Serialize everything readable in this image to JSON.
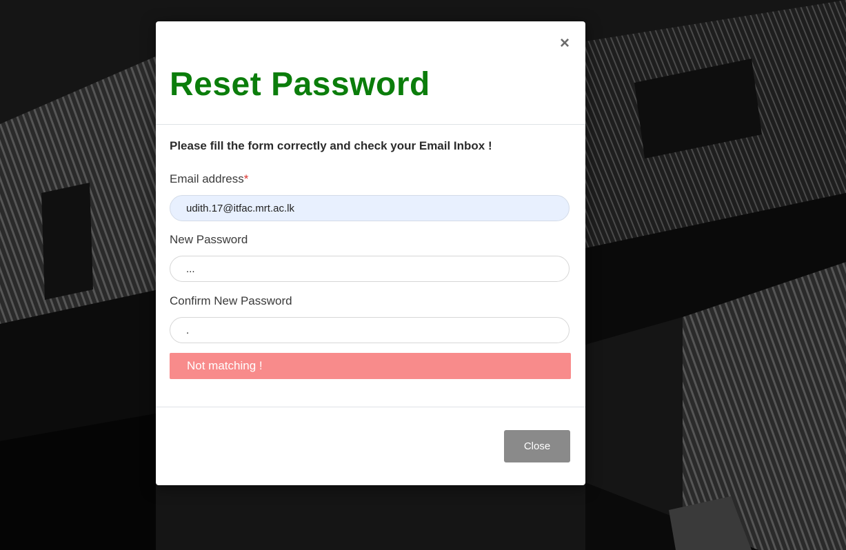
{
  "modal": {
    "title": "Reset Password",
    "close_icon": "×",
    "instruction": "Please fill the form correctly and check your Email Inbox !",
    "email": {
      "label": "Email address",
      "required_mark": "*",
      "value": "udith.17@itfac.mrt.ac.lk"
    },
    "new_password": {
      "label": "New Password",
      "value": "...",
      "masked_display": "..."
    },
    "confirm_password": {
      "label": "Confirm New Password",
      "value": ".",
      "masked_display": "."
    },
    "error_message": "Not matching !",
    "footer": {
      "close_label": "Close"
    }
  },
  "colors": {
    "title": "#0b7d0b",
    "error_background": "#f88b8b",
    "close_button": "#8a8a8a",
    "autofill_background": "#e8f0fe"
  },
  "icons": {
    "close": "close-icon"
  }
}
